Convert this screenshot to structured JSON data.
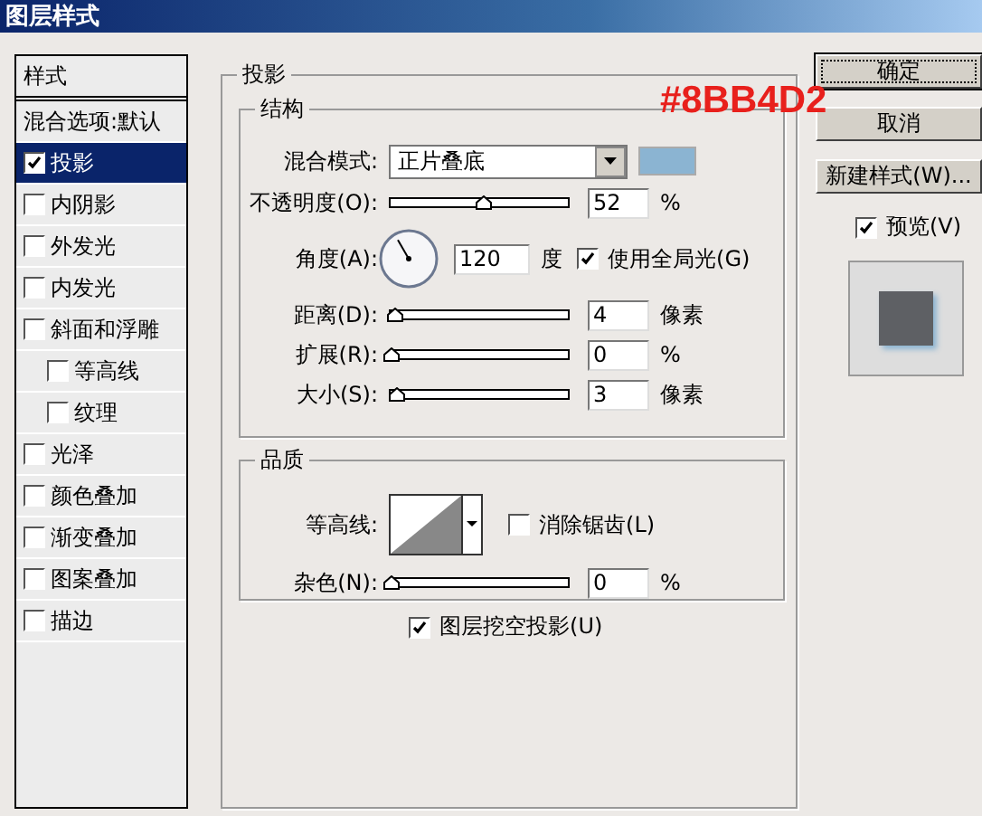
{
  "window": {
    "title": "图层样式"
  },
  "styles_list": {
    "header": "样式",
    "items": [
      {
        "label": "混合选项:默认",
        "kind": "plain",
        "selected": false
      },
      {
        "label": "投影",
        "kind": "check",
        "checked": true,
        "selected": true
      },
      {
        "label": "内阴影",
        "kind": "check",
        "checked": false,
        "selected": false
      },
      {
        "label": "外发光",
        "kind": "check",
        "checked": false,
        "selected": false
      },
      {
        "label": "内发光",
        "kind": "check",
        "checked": false,
        "selected": false
      },
      {
        "label": "斜面和浮雕",
        "kind": "check",
        "checked": false,
        "selected": false,
        "children": [
          {
            "label": "等高线",
            "kind": "check",
            "checked": false,
            "selected": false
          },
          {
            "label": "纹理",
            "kind": "check",
            "checked": false,
            "selected": false
          }
        ]
      },
      {
        "label": "光泽",
        "kind": "check",
        "checked": false,
        "selected": false
      },
      {
        "label": "颜色叠加",
        "kind": "check",
        "checked": false,
        "selected": false
      },
      {
        "label": "渐变叠加",
        "kind": "check",
        "checked": false,
        "selected": false
      },
      {
        "label": "图案叠加",
        "kind": "check",
        "checked": false,
        "selected": false
      },
      {
        "label": "描边",
        "kind": "check",
        "checked": false,
        "selected": false
      }
    ]
  },
  "panel": {
    "title": "投影",
    "structure": {
      "title": "结构",
      "blend_mode": {
        "label": "混合模式:",
        "value": "正片叠底",
        "color": "#8BB4D2"
      },
      "annotation": "#8BB4D2",
      "rows": [
        {
          "kind": "slider",
          "label": "不透明度(O):",
          "level": 0.52,
          "value": "52",
          "unit": "%"
        },
        {
          "kind": "angle",
          "label": "角度(A):",
          "value": "120",
          "unit": "度",
          "option": {
            "label": "使用全局光(G)",
            "checked": true
          }
        },
        {
          "kind": "slider",
          "label": "距离(D):",
          "level": 0.02,
          "value": "4",
          "unit": "像素"
        },
        {
          "kind": "slider",
          "label": "扩展(R):",
          "level": 0,
          "value": "0",
          "unit": "%"
        },
        {
          "kind": "slider",
          "label": "大小(S):",
          "level": 0.03,
          "value": "3",
          "unit": "像素"
        }
      ]
    },
    "quality": {
      "title": "品质",
      "contour": {
        "label": "等高线:",
        "option": {
          "label": "消除锯齿(L)",
          "checked": false
        }
      },
      "noise": {
        "label": "杂色(N):",
        "level": 0,
        "value": "0",
        "unit": "%"
      }
    },
    "knockout": {
      "label": "图层挖空投影(U)",
      "checked": true
    }
  },
  "buttons": [
    {
      "label": "确定",
      "default": true
    },
    {
      "label": "取消",
      "default": false
    },
    {
      "label": "新建样式(W)...",
      "default": false
    }
  ],
  "preview": {
    "label": "预览(V)",
    "checked": true
  }
}
